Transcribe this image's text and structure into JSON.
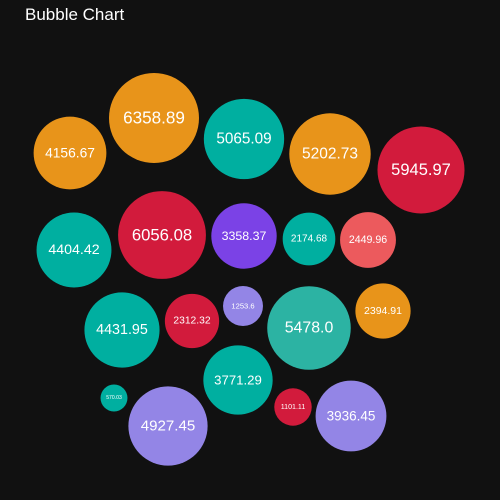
{
  "chart_data": {
    "type": "bubble",
    "title": "Bubble Chart",
    "palette": {
      "orange": "#E8941A",
      "teal": "#00AFA0",
      "crimson": "#D21B3C",
      "purple": "#7B42E6",
      "salmon": "#EC5A5D",
      "lavender": "#9385E6",
      "seagreen": "#2CB3A3"
    },
    "bubbles": [
      {
        "label": "4156.67",
        "value": 4156.67,
        "color": "orange"
      },
      {
        "label": "6358.89",
        "value": 6358.89,
        "color": "orange"
      },
      {
        "label": "5065.09",
        "value": 5065.09,
        "color": "teal"
      },
      {
        "label": "5202.73",
        "value": 5202.73,
        "color": "orange"
      },
      {
        "label": "5945.97",
        "value": 5945.97,
        "color": "crimson"
      },
      {
        "label": "4404.42",
        "value": 4404.42,
        "color": "teal"
      },
      {
        "label": "6056.08",
        "value": 6056.08,
        "color": "crimson"
      },
      {
        "label": "3358.37",
        "value": 3358.37,
        "color": "purple"
      },
      {
        "label": "2174.68",
        "value": 2174.68,
        "color": "teal"
      },
      {
        "label": "2449.96",
        "value": 2449.96,
        "color": "salmon"
      },
      {
        "label": "4431.95",
        "value": 4431.95,
        "color": "teal"
      },
      {
        "label": "2312.32",
        "value": 2312.32,
        "color": "crimson"
      },
      {
        "label": "1253.6",
        "value": 1253.6,
        "color": "lavender"
      },
      {
        "label": "5478.0",
        "value": 5478.0,
        "color": "seagreen"
      },
      {
        "label": "2394.91",
        "value": 2394.91,
        "color": "orange"
      },
      {
        "label": "3771.29",
        "value": 3771.29,
        "color": "teal"
      },
      {
        "label": "570.03",
        "value": 570.03,
        "color": "teal"
      },
      {
        "label": "4927.45",
        "value": 4927.45,
        "color": "lavender"
      },
      {
        "label": "1101.11",
        "value": 1101.11,
        "color": "crimson"
      },
      {
        "label": "3936.45",
        "value": 3936.45,
        "color": "lavender"
      }
    ]
  }
}
